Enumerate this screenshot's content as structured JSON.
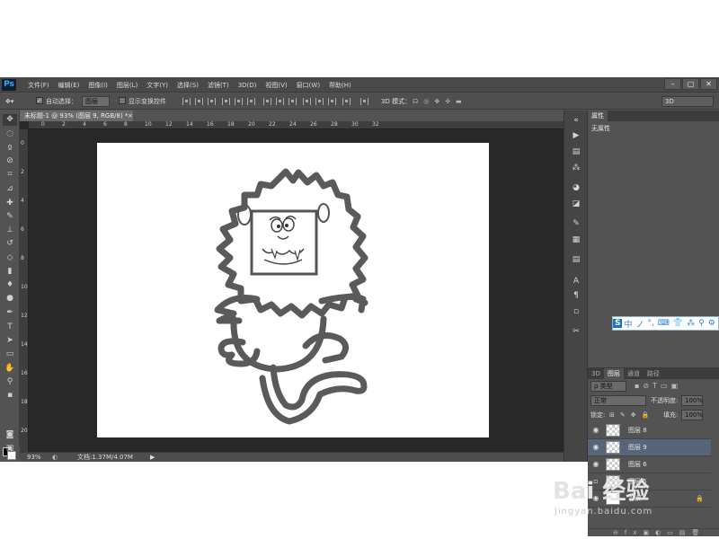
{
  "app": {
    "logo": "Ps"
  },
  "menu": [
    "文件(F)",
    "编辑(E)",
    "图像(I)",
    "图层(L)",
    "文字(Y)",
    "选择(S)",
    "滤镜(T)",
    "3D(D)",
    "视图(V)",
    "窗口(W)",
    "帮助(H)"
  ],
  "window_controls": [
    "–",
    "▢",
    "✕"
  ],
  "options": {
    "auto_select_label": "自动选择：",
    "auto_select_value": "图层",
    "show_transform_label": "显示变换控件",
    "mode_3d_label": "3D 模式：",
    "workspace_value": "3D"
  },
  "document": {
    "tab_title": "未标题-1 @ 93% (图层 9, RGB/8) *",
    "ruler_top": [
      "0",
      "2",
      "4",
      "6",
      "8",
      "10",
      "12",
      "14",
      "16",
      "18",
      "20",
      "22",
      "24",
      "26",
      "28",
      "30",
      "32"
    ],
    "ruler_left": [
      "0",
      "2",
      "4",
      "6",
      "8",
      "10",
      "12",
      "14",
      "16",
      "18",
      "20"
    ]
  },
  "status": {
    "zoom": "93%",
    "doc_info": "文档:1.37M/4.07M",
    "arrow": "▶"
  },
  "properties": {
    "tab": "属性",
    "text": "无属性"
  },
  "layers_panel": {
    "tabs": [
      "3D",
      "图层",
      "通道",
      "路径"
    ],
    "filter_label": "ρ 类型",
    "blend_mode": "正常",
    "opacity_label": "不透明度:",
    "opacity_value": "100%",
    "lock_label": "锁定:",
    "fill_label": "填充:",
    "fill_value": "100%",
    "layers": [
      {
        "name": "图层 8",
        "visible": true,
        "selected": false
      },
      {
        "name": "图层 9",
        "visible": true,
        "selected": true
      },
      {
        "name": "图层 6",
        "visible": true,
        "selected": false
      },
      {
        "name": "图层 5",
        "visible": false,
        "selected": false
      },
      {
        "name": "背景",
        "visible": true,
        "selected": false,
        "locked": true
      }
    ]
  },
  "ime_bar": [
    "中",
    "ノ",
    "°,",
    "⌨",
    "👕",
    "⁂",
    "⚲",
    "⚙"
  ],
  "watermark": {
    "main": "Bai 经验",
    "url": "jingyan.baidu.com"
  }
}
